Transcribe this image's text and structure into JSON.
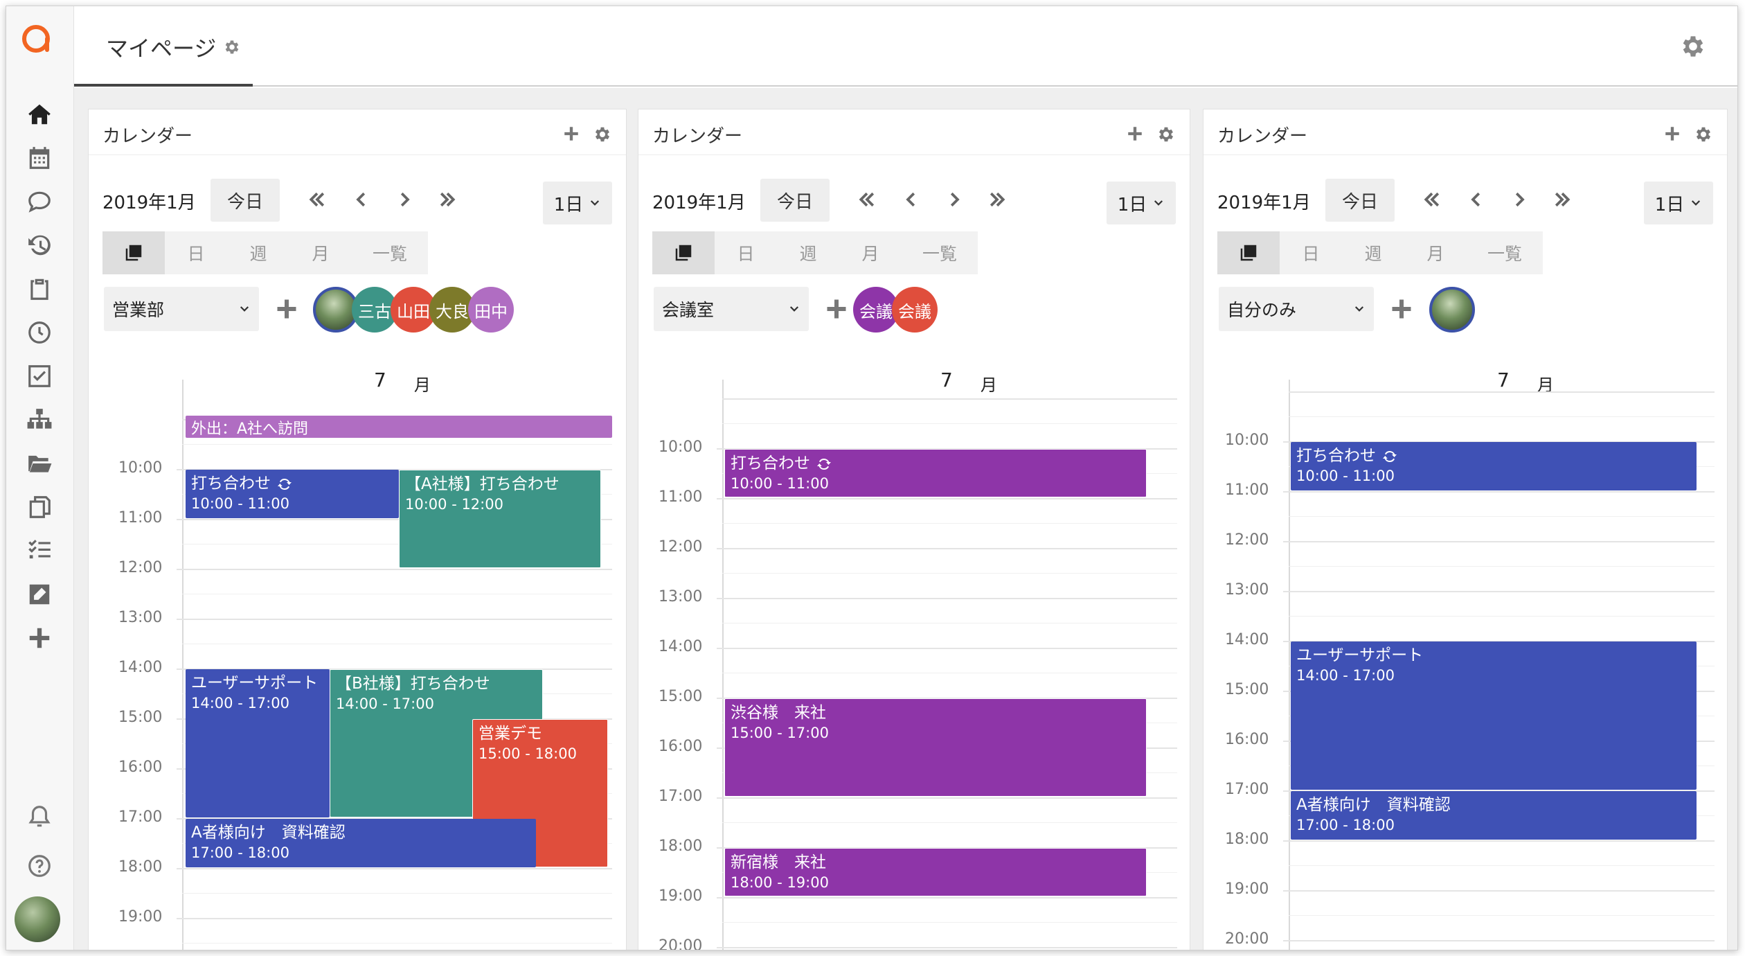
{
  "app": {
    "tab_label": "マイページ"
  },
  "sidebar": {
    "items": [
      "home-icon",
      "calendar-icon",
      "chat-icon",
      "history-icon",
      "clipboard-icon",
      "clock-icon",
      "checkbox-icon",
      "org-chart-icon",
      "folder-icon",
      "copy-icon",
      "checklist-icon",
      "edit-icon",
      "plus-icon"
    ],
    "bottom": [
      "bell-icon",
      "help-icon",
      "avatar"
    ]
  },
  "panels": [
    {
      "title": "カレンダー",
      "month": "2019年1月",
      "today": "今日",
      "range": "1日",
      "views": [
        "日",
        "週",
        "月",
        "一覧"
      ],
      "group": "営業部",
      "members": [
        {
          "label": "",
          "color": "photo"
        },
        {
          "label": "三古",
          "color": "#3d9587"
        },
        {
          "label": "山田",
          "color": "#e04e3c"
        },
        {
          "label": "大良",
          "color": "#7d7a2a"
        },
        {
          "label": "田中",
          "color": "#b06dc2"
        }
      ],
      "day": "7",
      "day_unit": "月",
      "hours": [
        "10:00",
        "11:00",
        "12:00",
        "13:00",
        "14:00",
        "15:00",
        "16:00",
        "17:00",
        "18:00",
        "19:00"
      ],
      "allday": "外出：A社へ訪問",
      "events": [
        {
          "title": "打ち合わせ",
          "time": "10:00 - 11:00",
          "repeat": true
        },
        {
          "title": "【A社様】打ち合わせ",
          "time": "10:00 - 12:00"
        },
        {
          "title": "ユーザーサポート",
          "time": "14:00 - 17:00"
        },
        {
          "title": "【B社様】打ち合わせ",
          "time": "14:00 - 17:00"
        },
        {
          "title": "営業デモ",
          "time": "15:00 - 18:00"
        },
        {
          "title": "A者様向け　資料確認",
          "time": "17:00 - 18:00"
        }
      ]
    },
    {
      "title": "カレンダー",
      "month": "2019年1月",
      "today": "今日",
      "range": "1日",
      "views": [
        "日",
        "週",
        "月",
        "一覧"
      ],
      "group": "会議室",
      "members": [
        {
          "label": "会議",
          "color": "#8e35a8"
        },
        {
          "label": "会議",
          "color": "#e04e3c"
        }
      ],
      "day": "7",
      "day_unit": "月",
      "hours": [
        "10:00",
        "11:00",
        "12:00",
        "13:00",
        "14:00",
        "15:00",
        "16:00",
        "17:00",
        "18:00",
        "19:00",
        "20:00"
      ],
      "events": [
        {
          "title": "打ち合わせ",
          "time": "10:00 - 11:00",
          "repeat": true
        },
        {
          "title": "渋谷様　来社",
          "time": "15:00 - 17:00"
        },
        {
          "title": "新宿様　来社",
          "time": "18:00 - 19:00"
        }
      ]
    },
    {
      "title": "カレンダー",
      "month": "2019年1月",
      "today": "今日",
      "range": "1日",
      "views": [
        "日",
        "週",
        "月",
        "一覧"
      ],
      "group": "自分のみ",
      "members": [
        {
          "label": "",
          "color": "photo"
        }
      ],
      "day": "7",
      "day_unit": "月",
      "hours": [
        "10:00",
        "11:00",
        "12:00",
        "13:00",
        "14:00",
        "15:00",
        "16:00",
        "17:00",
        "18:00",
        "19:00",
        "20:00"
      ],
      "events": [
        {
          "title": "打ち合わせ",
          "time": "10:00 - 11:00",
          "repeat": true
        },
        {
          "title": "ユーザーサポート",
          "time": "14:00 - 17:00"
        },
        {
          "title": "A者様向け　資料確認",
          "time": "17:00 - 18:00"
        }
      ]
    }
  ],
  "colors": {
    "accent": "#f26522",
    "blue": "#3f51b5",
    "teal": "#3d9587",
    "red": "#e04e3c",
    "purple": "#8e35a8",
    "allday": "#b06dc2"
  }
}
